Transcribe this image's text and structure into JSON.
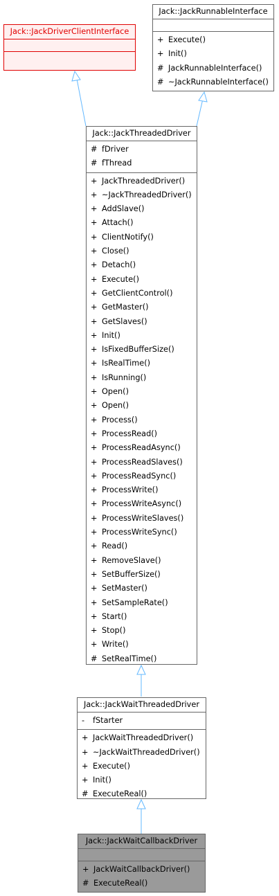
{
  "classes": {
    "driver_client": {
      "name": "Jack::JackDriverClientInterface",
      "attributes": [],
      "methods": []
    },
    "runnable": {
      "name": "Jack::JackRunnableInterface",
      "attributes": [],
      "methods": [
        {
          "vis": "+",
          "name": "Execute()"
        },
        {
          "vis": "+",
          "name": "Init()"
        },
        {
          "vis": "#",
          "name": "JackRunnableInterface()"
        },
        {
          "vis": "#",
          "name": "~JackRunnableInterface()"
        }
      ]
    },
    "threaded": {
      "name": "Jack::JackThreadedDriver",
      "attributes": [
        {
          "vis": "#",
          "name": "fDriver"
        },
        {
          "vis": "#",
          "name": "fThread"
        }
      ],
      "methods": [
        {
          "vis": "+",
          "name": "JackThreadedDriver()"
        },
        {
          "vis": "+",
          "name": "~JackThreadedDriver()"
        },
        {
          "vis": "+",
          "name": "AddSlave()"
        },
        {
          "vis": "+",
          "name": "Attach()"
        },
        {
          "vis": "+",
          "name": "ClientNotify()"
        },
        {
          "vis": "+",
          "name": "Close()"
        },
        {
          "vis": "+",
          "name": "Detach()"
        },
        {
          "vis": "+",
          "name": "Execute()"
        },
        {
          "vis": "+",
          "name": "GetClientControl()"
        },
        {
          "vis": "+",
          "name": "GetMaster()"
        },
        {
          "vis": "+",
          "name": "GetSlaves()"
        },
        {
          "vis": "+",
          "name": "Init()"
        },
        {
          "vis": "+",
          "name": "IsFixedBufferSize()"
        },
        {
          "vis": "+",
          "name": "IsRealTime()"
        },
        {
          "vis": "+",
          "name": "IsRunning()"
        },
        {
          "vis": "+",
          "name": "Open()"
        },
        {
          "vis": "+",
          "name": "Open()"
        },
        {
          "vis": "+",
          "name": "Process()"
        },
        {
          "vis": "+",
          "name": "ProcessRead()"
        },
        {
          "vis": "+",
          "name": "ProcessReadAsync()"
        },
        {
          "vis": "+",
          "name": "ProcessReadSlaves()"
        },
        {
          "vis": "+",
          "name": "ProcessReadSync()"
        },
        {
          "vis": "+",
          "name": "ProcessWrite()"
        },
        {
          "vis": "+",
          "name": "ProcessWriteAsync()"
        },
        {
          "vis": "+",
          "name": "ProcessWriteSlaves()"
        },
        {
          "vis": "+",
          "name": "ProcessWriteSync()"
        },
        {
          "vis": "+",
          "name": "Read()"
        },
        {
          "vis": "+",
          "name": "RemoveSlave()"
        },
        {
          "vis": "+",
          "name": "SetBufferSize()"
        },
        {
          "vis": "+",
          "name": "SetMaster()"
        },
        {
          "vis": "+",
          "name": "SetSampleRate()"
        },
        {
          "vis": "+",
          "name": "Start()"
        },
        {
          "vis": "+",
          "name": "Stop()"
        },
        {
          "vis": "+",
          "name": "Write()"
        },
        {
          "vis": "#",
          "name": "SetRealTime()"
        }
      ]
    },
    "wait_threaded": {
      "name": "Jack::JackWaitThreadedDriver",
      "attributes": [
        {
          "vis": "-",
          "name": "fStarter"
        }
      ],
      "methods": [
        {
          "vis": "+",
          "name": "JackWaitThreadedDriver()"
        },
        {
          "vis": "+",
          "name": "~JackWaitThreadedDriver()"
        },
        {
          "vis": "+",
          "name": "Execute()"
        },
        {
          "vis": "+",
          "name": "Init()"
        },
        {
          "vis": "#",
          "name": "ExecuteReal()"
        }
      ]
    },
    "wait_callback": {
      "name": "Jack::JackWaitCallbackDriver",
      "attributes": [],
      "methods": [
        {
          "vis": "+",
          "name": "JackWaitCallbackDriver()"
        },
        {
          "vis": "#",
          "name": "ExecuteReal()"
        }
      ]
    }
  },
  "colors": {
    "edge": "#63b8ff",
    "border": "#666666",
    "interface_border": "#e00000",
    "interface_fill": "#fff0f0",
    "focus_fill": "#9a9a9a"
  }
}
